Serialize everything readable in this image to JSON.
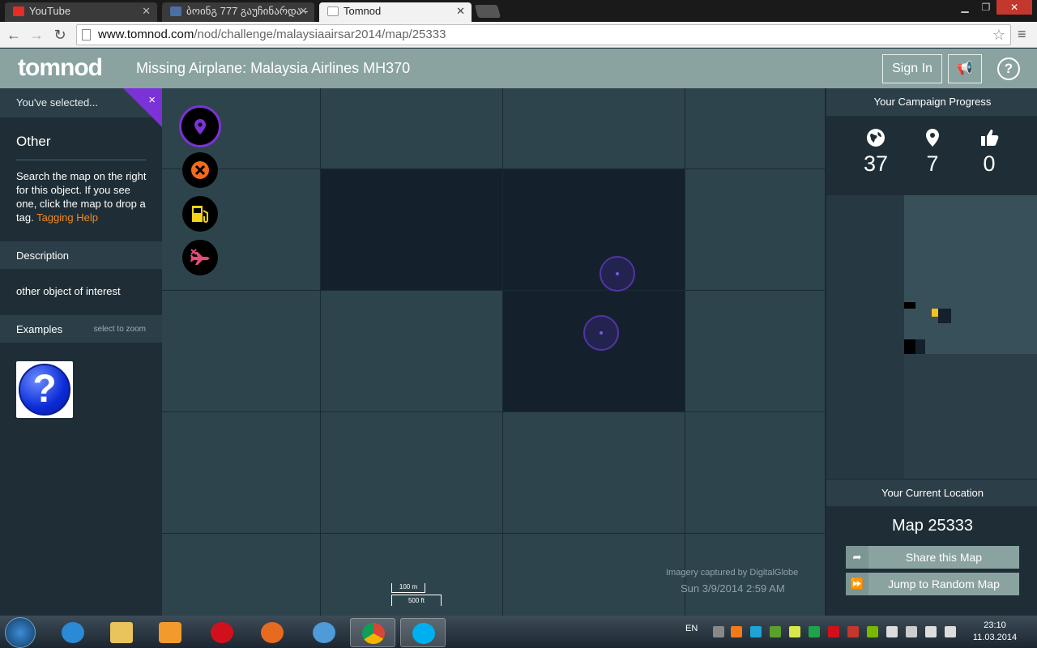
{
  "browser": {
    "tabs": [
      {
        "label": "YouTube",
        "active": false
      },
      {
        "label": "ბოინგ 777 გაუჩინარდა -",
        "active": false
      },
      {
        "label": "Tomnod",
        "active": true
      }
    ],
    "url_host": "www.tomnod.com",
    "url_path": "/nod/challenge/malaysiaairsar2014/map/25333"
  },
  "header": {
    "logo": "tomnod",
    "title": "Missing Airplane: Malaysia Airlines MH370",
    "sign_in": "Sign In",
    "help": "?"
  },
  "left_panel": {
    "selected_heading": "You've selected...",
    "close": "×",
    "object_name": "Other",
    "help_text": "Search the map on the right for this object. If you see one, click the map to drop a tag.",
    "help_link": "Tagging Help",
    "description_heading": "Description",
    "description": "other object of interest",
    "examples_heading": "Examples",
    "examples_hint": "select to zoom",
    "example_glyph": "?"
  },
  "map": {
    "tools": [
      {
        "icon": "map-pin-icon",
        "color": "#7b32d6",
        "selected": true
      },
      {
        "icon": "close-circle-icon",
        "color": "#f26b1d",
        "selected": false
      },
      {
        "icon": "fuel-icon",
        "color": "#f2d21d",
        "selected": false
      },
      {
        "icon": "crashed-plane-icon",
        "color": "#e84a78",
        "selected": false
      }
    ],
    "credit": "Imagery captured by DigitalGlobe",
    "date": "Sun 3/9/2014 2:59 AM",
    "scale_m": "100 m",
    "scale_ft": "500 ft"
  },
  "right_panel": {
    "progress_heading": "Your Campaign Progress",
    "stats": [
      {
        "icon": "globe-icon",
        "value": "37"
      },
      {
        "icon": "map-pin-icon",
        "value": "7"
      },
      {
        "icon": "thumbs-up-icon",
        "value": "0"
      }
    ],
    "location_heading": "Your Current Location",
    "map_label": "Map 25333",
    "share_label": "Share this Map",
    "jump_label": "Jump to Random Map"
  },
  "taskbar": {
    "lang": "EN",
    "time": "23:10",
    "date": "11.03.2014"
  },
  "colors": {
    "accent": "#7b32d6",
    "header": "#8aa3a0",
    "link": "#f28a1e",
    "panel": "#1f2e36"
  }
}
